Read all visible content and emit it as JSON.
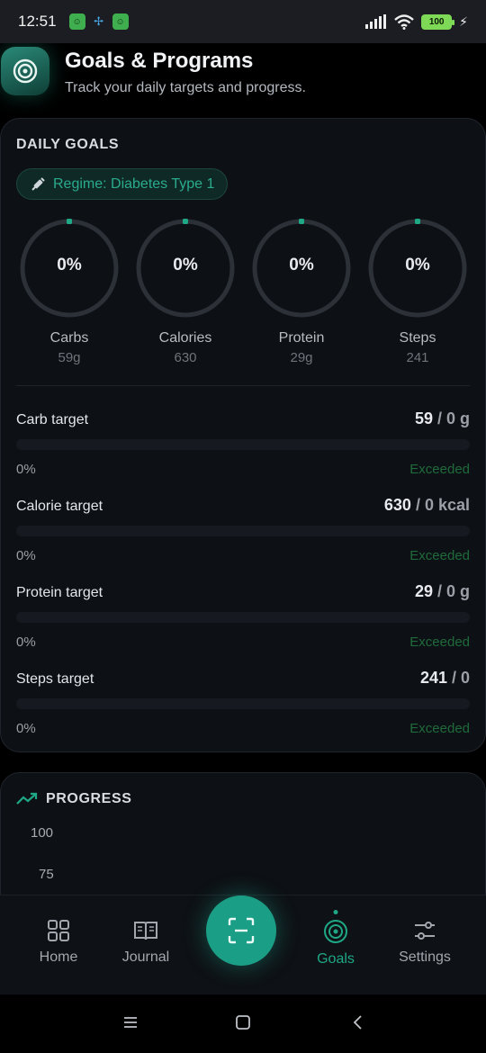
{
  "status_bar": {
    "time": "12:51",
    "battery": "100",
    "icons": [
      "app-notification-icon",
      "fan-icon",
      "app-notification-icon",
      "signal-icon",
      "wifi-icon",
      "battery-icon",
      "charging-icon"
    ]
  },
  "header": {
    "title": "Goals & Programs",
    "subtitle": "Track your daily targets and progress.",
    "icon": "target-icon"
  },
  "daily_goals": {
    "section_title": "DAILY GOALS",
    "regime_label": "Regime: Diabetes Type 1",
    "regime_icon": "syringe-icon",
    "rings": [
      {
        "percent_label": "0%",
        "label": "Carbs",
        "sub": "59g",
        "progress": 0
      },
      {
        "percent_label": "0%",
        "label": "Calories",
        "sub": "630",
        "progress": 0
      },
      {
        "percent_label": "0%",
        "label": "Protein",
        "sub": "29g",
        "progress": 0
      },
      {
        "percent_label": "0%",
        "label": "Steps",
        "sub": "241",
        "progress": 0
      }
    ],
    "targets": [
      {
        "label": "Carb target",
        "current": "59",
        "goal": " / 0 g",
        "percent_label": "0%",
        "status": "Exceeded",
        "progress": 0
      },
      {
        "label": "Calorie target",
        "current": "630",
        "goal": " / 0 kcal",
        "percent_label": "0%",
        "status": "Exceeded",
        "progress": 0
      },
      {
        "label": "Protein target",
        "current": "29",
        "goal": " / 0 g",
        "percent_label": "0%",
        "status": "Exceeded",
        "progress": 0
      },
      {
        "label": "Steps target",
        "current": "241",
        "goal": " / 0",
        "percent_label": "0%",
        "status": "Exceeded",
        "progress": 0
      }
    ]
  },
  "progress": {
    "section_title": "PROGRESS",
    "icon": "trending-up-icon",
    "y_ticks": [
      "100",
      "75"
    ]
  },
  "bottom_nav": {
    "items": [
      {
        "label": "Home",
        "icon": "grid-icon"
      },
      {
        "label": "Journal",
        "icon": "book-icon"
      },
      {
        "label": "Goals",
        "icon": "target-icon",
        "active": true
      },
      {
        "label": "Settings",
        "icon": "sliders-icon"
      }
    ],
    "scan_icon": "scan-icon"
  },
  "colors": {
    "accent": "#1fa886",
    "exceeded": "#1f6b3c",
    "card": "#0d1015",
    "background": "#000000"
  }
}
